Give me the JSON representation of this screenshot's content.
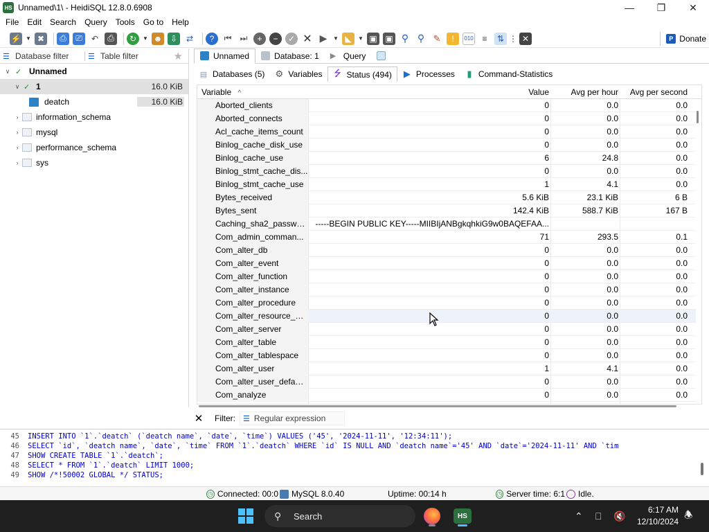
{
  "window": {
    "title": "Unnamed\\1\\ - HeidiSQL 12.8.0.6908",
    "app_icon_text": "HS"
  },
  "menu": [
    "File",
    "Edit",
    "Search",
    "Query",
    "Tools",
    "Go to",
    "Help"
  ],
  "toolbar": {
    "donate_label": "Donate"
  },
  "left_panel": {
    "tabs": [
      "Database filter",
      "Table filter"
    ],
    "tree": [
      {
        "label": "Unnamed",
        "size": "",
        "level": 0,
        "expanded": true,
        "bold": true
      },
      {
        "label": "1",
        "size": "16.0 KiB",
        "level": 1,
        "expanded": true,
        "selected": true
      },
      {
        "label": "deatch",
        "size": "16.0 KiB",
        "level": 2
      },
      {
        "label": "information_schema",
        "size": "",
        "level": 1
      },
      {
        "label": "mysql",
        "size": "",
        "level": 1
      },
      {
        "label": "performance_schema",
        "size": "",
        "level": 1
      },
      {
        "label": "sys",
        "size": "",
        "level": 1
      }
    ]
  },
  "main_tabs": [
    {
      "label": "Unnamed",
      "active": true
    },
    {
      "label": "Database: 1",
      "active": false
    },
    {
      "label": "Query",
      "active": false
    }
  ],
  "sub_tabs": [
    {
      "label": "Databases (5)",
      "active": false
    },
    {
      "label": "Variables",
      "active": false
    },
    {
      "label": "Status (494)",
      "active": true
    },
    {
      "label": "Processes",
      "active": false
    },
    {
      "label": "Command-Statistics",
      "active": false
    }
  ],
  "grid": {
    "columns": [
      "Variable",
      "Value",
      "Avg per hour",
      "Avg per second"
    ],
    "sort_indicator": "^",
    "rows": [
      [
        "Aborted_clients",
        "0",
        "0.0",
        "0.0"
      ],
      [
        "Aborted_connects",
        "0",
        "0.0",
        "0.0"
      ],
      [
        "Acl_cache_items_count",
        "0",
        "0.0",
        "0.0"
      ],
      [
        "Binlog_cache_disk_use",
        "0",
        "0.0",
        "0.0"
      ],
      [
        "Binlog_cache_use",
        "6",
        "24.8",
        "0.0"
      ],
      [
        "Binlog_stmt_cache_dis...",
        "0",
        "0.0",
        "0.0"
      ],
      [
        "Binlog_stmt_cache_use",
        "1",
        "4.1",
        "0.0"
      ],
      [
        "Bytes_received",
        "5.6 KiB",
        "23.1 KiB",
        "6 B"
      ],
      [
        "Bytes_sent",
        "142.4 KiB",
        "588.7 KiB",
        "167 B"
      ],
      [
        "Caching_sha2_passwo...",
        "-----BEGIN PUBLIC KEY-----MIIBIjANBgkqhkiG9w0BAQEFAA...",
        "",
        ""
      ],
      [
        "Com_admin_comman...",
        "71",
        "293.5",
        "0.1"
      ],
      [
        "Com_alter_db",
        "0",
        "0.0",
        "0.0"
      ],
      [
        "Com_alter_event",
        "0",
        "0.0",
        "0.0"
      ],
      [
        "Com_alter_function",
        "0",
        "0.0",
        "0.0"
      ],
      [
        "Com_alter_instance",
        "0",
        "0.0",
        "0.0"
      ],
      [
        "Com_alter_procedure",
        "0",
        "0.0",
        "0.0"
      ],
      [
        "Com_alter_resource_gr...",
        "0",
        "0.0",
        "0.0"
      ],
      [
        "Com_alter_server",
        "0",
        "0.0",
        "0.0"
      ],
      [
        "Com_alter_table",
        "0",
        "0.0",
        "0.0"
      ],
      [
        "Com_alter_tablespace",
        "0",
        "0.0",
        "0.0"
      ],
      [
        "Com_alter_user",
        "1",
        "4.1",
        "0.0"
      ],
      [
        "Com_alter_user_defaul...",
        "0",
        "0.0",
        "0.0"
      ],
      [
        "Com_analyze",
        "0",
        "0.0",
        "0.0"
      ]
    ],
    "highlighted_row": 16
  },
  "filter": {
    "label": "Filter:",
    "placeholder": "Regular expression"
  },
  "sql_log": [
    {
      "n": "45",
      "text": "INSERT INTO `1`.`deatch` (`deatch name`, `date`, `time`) VALUES ('45', '2024-11-11', '12:34:11');",
      "comment": false
    },
    {
      "n": "46",
      "text": "SELECT `id`, `deatch name`, `date`, `time` FROM `1`.`deatch` WHERE  `id` IS NULL AND `deatch name`='45' AND `date`='2024-11-11' AND `tim",
      "comment": false
    },
    {
      "n": "47",
      "text": "SHOW CREATE TABLE `1`.`deatch`;",
      "comment": false
    },
    {
      "n": "48",
      "text": "SELECT * FROM `1`.`deatch` LIMIT 1000;",
      "comment": false
    },
    {
      "n": "49",
      "text": "SHOW /*!50002 GLOBAL */ STATUS;",
      "comment": false
    }
  ],
  "statusbar": {
    "connected": "Connected: 00:0",
    "server": "MySQL 8.0.40",
    "uptime": "Uptime: 00:14 h",
    "server_time": "Server time: 6:1",
    "state": "Idle."
  },
  "taskbar": {
    "search_label": "Search",
    "time": "6:17 AM",
    "date": "12/10/2024",
    "accent": "#4cc2ff"
  }
}
